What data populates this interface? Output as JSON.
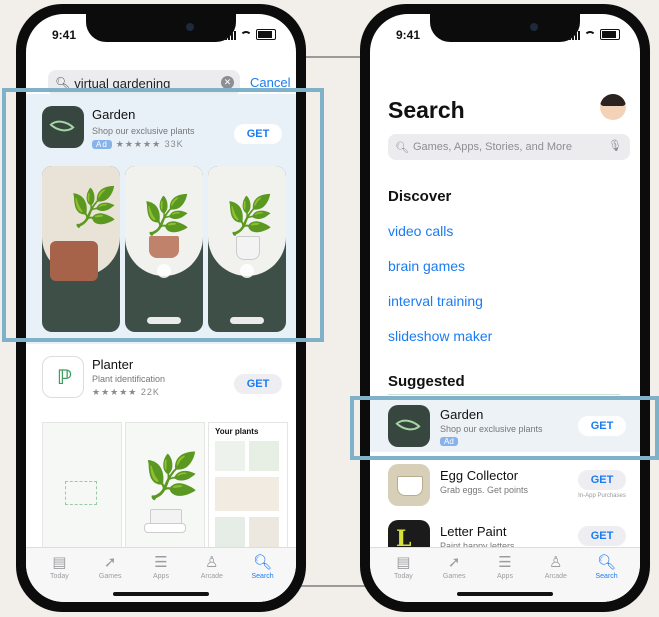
{
  "status": {
    "time": "9:41"
  },
  "left_phone": {
    "search": {
      "query": "virtual gardening",
      "cancel_label": "Cancel"
    },
    "results": [
      {
        "name": "Garden",
        "subtitle": "Shop our exclusive plants",
        "ad_label": "Ad",
        "rating": "★★★★★",
        "rating_count": "33K",
        "get_label": "GET",
        "screenshot_captions": [
          "",
          "",
          ""
        ]
      },
      {
        "name": "Planter",
        "subtitle": "Plant identification",
        "rating": "★★★★★",
        "rating_count": "22K",
        "get_label": "GET",
        "shot_caption": "Your plants"
      }
    ],
    "tabs": [
      "Today",
      "Games",
      "Apps",
      "Arcade",
      "Search"
    ]
  },
  "right_phone": {
    "title": "Search",
    "search_placeholder": "Games, Apps, Stories, and More",
    "discover_heading": "Discover",
    "discover_links": [
      "video calls",
      "brain games",
      "interval training",
      "slideshow maker"
    ],
    "suggested_heading": "Suggested",
    "suggested": [
      {
        "name": "Garden",
        "subtitle": "Shop our exclusive plants",
        "ad_label": "Ad",
        "get_label": "GET"
      },
      {
        "name": "Egg Collector",
        "subtitle": "Grab eggs. Get points",
        "get_label": "GET",
        "note": "In-App Purchases"
      },
      {
        "name": "Letter Paint",
        "subtitle": "Paint happy letters",
        "get_label": "GET"
      }
    ],
    "tabs": [
      "Today",
      "Games",
      "Apps",
      "Arcade",
      "Search"
    ]
  },
  "colors": {
    "accent": "#1a7cf2",
    "highlight": "#7fb1c8"
  }
}
